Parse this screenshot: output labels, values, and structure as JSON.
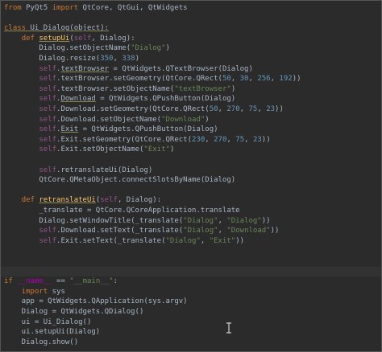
{
  "code": {
    "lines": [
      [
        {
          "t": "from",
          "c": "kw"
        },
        {
          "t": " PyQt5 ",
          "c": ""
        },
        {
          "t": "import",
          "c": "kw"
        },
        {
          "t": " QtCore, QtGui, QtWidgets",
          "c": ""
        }
      ],
      [],
      [
        {
          "t": "class",
          "c": "kw und"
        },
        {
          "t": " Ui_Dialog(object):",
          "c": "und"
        }
      ],
      [
        {
          "t": "    ",
          "c": ""
        },
        {
          "t": "def",
          "c": "kw"
        },
        {
          "t": " ",
          "c": ""
        },
        {
          "t": "setupUi",
          "c": "fn und"
        },
        {
          "t": "(",
          "c": ""
        },
        {
          "t": "self",
          "c": "slf"
        },
        {
          "t": ", Dialog):",
          "c": ""
        }
      ],
      [
        {
          "t": "        Dialog.setObjectName(",
          "c": ""
        },
        {
          "t": "\"Dialog\"",
          "c": "str"
        },
        {
          "t": ")",
          "c": ""
        }
      ],
      [
        {
          "t": "        Dialog.resize(",
          "c": ""
        },
        {
          "t": "350",
          "c": "num"
        },
        {
          "t": ", ",
          "c": ""
        },
        {
          "t": "338",
          "c": "num"
        },
        {
          "t": ")",
          "c": ""
        }
      ],
      [
        {
          "t": "        ",
          "c": ""
        },
        {
          "t": "self",
          "c": "slf"
        },
        {
          "t": ".",
          "c": ""
        },
        {
          "t": "textBrowser",
          "c": "und"
        },
        {
          "t": " = QtWidgets.QTextBrowser(Dialog)",
          "c": ""
        }
      ],
      [
        {
          "t": "        ",
          "c": ""
        },
        {
          "t": "self",
          "c": "slf"
        },
        {
          "t": ".textBrowser.setGeometry(QtCore.QRect(",
          "c": ""
        },
        {
          "t": "50",
          "c": "num"
        },
        {
          "t": ", ",
          "c": ""
        },
        {
          "t": "30",
          "c": "num"
        },
        {
          "t": ", ",
          "c": ""
        },
        {
          "t": "256",
          "c": "num"
        },
        {
          "t": ", ",
          "c": ""
        },
        {
          "t": "192",
          "c": "num"
        },
        {
          "t": "))",
          "c": ""
        }
      ],
      [
        {
          "t": "        ",
          "c": ""
        },
        {
          "t": "self",
          "c": "slf"
        },
        {
          "t": ".textBrowser.setObjectName(",
          "c": ""
        },
        {
          "t": "\"textBrowser\"",
          "c": "str"
        },
        {
          "t": ")",
          "c": ""
        }
      ],
      [
        {
          "t": "        ",
          "c": ""
        },
        {
          "t": "self",
          "c": "slf"
        },
        {
          "t": ".",
          "c": ""
        },
        {
          "t": "Download",
          "c": "und"
        },
        {
          "t": " = QtWidgets.QPushButton(Dialog)",
          "c": ""
        }
      ],
      [
        {
          "t": "        ",
          "c": ""
        },
        {
          "t": "self",
          "c": "slf"
        },
        {
          "t": ".Download.setGeometry(QtCore.QRect(",
          "c": ""
        },
        {
          "t": "50",
          "c": "num"
        },
        {
          "t": ", ",
          "c": ""
        },
        {
          "t": "270",
          "c": "num"
        },
        {
          "t": ", ",
          "c": ""
        },
        {
          "t": "75",
          "c": "num"
        },
        {
          "t": ", ",
          "c": ""
        },
        {
          "t": "23",
          "c": "num"
        },
        {
          "t": "))",
          "c": ""
        }
      ],
      [
        {
          "t": "        ",
          "c": ""
        },
        {
          "t": "self",
          "c": "slf"
        },
        {
          "t": ".Download.setObjectName(",
          "c": ""
        },
        {
          "t": "\"Download\"",
          "c": "str"
        },
        {
          "t": ")",
          "c": ""
        }
      ],
      [
        {
          "t": "        ",
          "c": ""
        },
        {
          "t": "self",
          "c": "slf"
        },
        {
          "t": ".",
          "c": ""
        },
        {
          "t": "Exit",
          "c": "und"
        },
        {
          "t": " = QtWidgets.QPushButton(Dialog)",
          "c": ""
        }
      ],
      [
        {
          "t": "        ",
          "c": ""
        },
        {
          "t": "self",
          "c": "slf"
        },
        {
          "t": ".Exit.setGeometry(QtCore.QRect(",
          "c": ""
        },
        {
          "t": "230",
          "c": "num"
        },
        {
          "t": ", ",
          "c": ""
        },
        {
          "t": "270",
          "c": "num"
        },
        {
          "t": ", ",
          "c": ""
        },
        {
          "t": "75",
          "c": "num"
        },
        {
          "t": ", ",
          "c": ""
        },
        {
          "t": "23",
          "c": "num"
        },
        {
          "t": "))",
          "c": ""
        }
      ],
      [
        {
          "t": "        ",
          "c": ""
        },
        {
          "t": "self",
          "c": "slf"
        },
        {
          "t": ".Exit.setObjectName(",
          "c": ""
        },
        {
          "t": "\"Exit\"",
          "c": "str"
        },
        {
          "t": ")",
          "c": ""
        }
      ],
      [],
      [
        {
          "t": "        ",
          "c": ""
        },
        {
          "t": "self",
          "c": "slf"
        },
        {
          "t": ".retranslateUi(Dialog)",
          "c": ""
        }
      ],
      [
        {
          "t": "        QtCore.QMetaObject.connectSlotsByName(Dialog)",
          "c": ""
        }
      ],
      [],
      [
        {
          "t": "    ",
          "c": ""
        },
        {
          "t": "def",
          "c": "kw"
        },
        {
          "t": " ",
          "c": ""
        },
        {
          "t": "retranslateUi",
          "c": "fn und"
        },
        {
          "t": "(",
          "c": ""
        },
        {
          "t": "self",
          "c": "slf"
        },
        {
          "t": ", Dialog):",
          "c": ""
        }
      ],
      [
        {
          "t": "        _translate = QtCore.QCoreApplication.translate",
          "c": ""
        }
      ],
      [
        {
          "t": "        Dialog.setWindowTitle(_translate(",
          "c": ""
        },
        {
          "t": "\"Dialog\"",
          "c": "str"
        },
        {
          "t": ", ",
          "c": ""
        },
        {
          "t": "\"Dialog\"",
          "c": "str"
        },
        {
          "t": "))",
          "c": ""
        }
      ],
      [
        {
          "t": "        ",
          "c": ""
        },
        {
          "t": "self",
          "c": "slf"
        },
        {
          "t": ".Download.setText(_translate(",
          "c": ""
        },
        {
          "t": "\"Dialog\"",
          "c": "str"
        },
        {
          "t": ", ",
          "c": ""
        },
        {
          "t": "\"Download\"",
          "c": "str"
        },
        {
          "t": "))",
          "c": ""
        }
      ],
      [
        {
          "t": "        ",
          "c": ""
        },
        {
          "t": "self",
          "c": "slf"
        },
        {
          "t": ".Exit.setText(_translate(",
          "c": ""
        },
        {
          "t": "\"Dialog\"",
          "c": "str"
        },
        {
          "t": ", ",
          "c": ""
        },
        {
          "t": "\"Exit\"",
          "c": "str"
        },
        {
          "t": "))",
          "c": ""
        }
      ],
      [],
      [],
      [
        {
          "t": "",
          "c": ""
        }
      ],
      [
        {
          "t": "if",
          "c": "kw"
        },
        {
          "t": " ",
          "c": ""
        },
        {
          "t": "__name__",
          "c": "mag"
        },
        {
          "t": " == ",
          "c": ""
        },
        {
          "t": "\"__main__\"",
          "c": "str"
        },
        {
          "t": ":",
          "c": ""
        }
      ],
      [
        {
          "t": "    ",
          "c": ""
        },
        {
          "t": "import",
          "c": "kw"
        },
        {
          "t": " sys",
          "c": ""
        }
      ],
      [
        {
          "t": "    app = QtWidgets.QApplication(sys.argv)",
          "c": ""
        }
      ],
      [
        {
          "t": "    Dialog = QtWidgets.QDialog()",
          "c": ""
        }
      ],
      [
        {
          "t": "    ui = Ui_Dialog()",
          "c": ""
        }
      ],
      [
        {
          "t": "    ui.setupUi(Dialog)",
          "c": ""
        }
      ],
      [
        {
          "t": "    Dialog.show()",
          "c": ""
        }
      ]
    ],
    "current_line": 26
  },
  "icons": {
    "caret": "i-beam-cursor-icon"
  }
}
